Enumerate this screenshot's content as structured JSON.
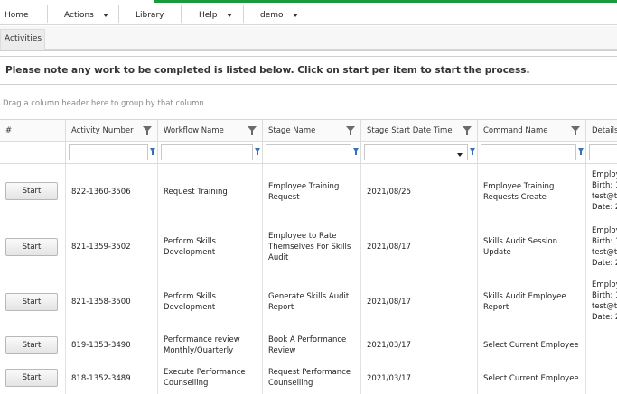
{
  "menu": {
    "home": "Home",
    "actions": "Actions",
    "library": "Library",
    "help": "Help",
    "user": "demo"
  },
  "tabs": {
    "activities": "Activities"
  },
  "notice": "Please note any work to be completed is listed below. Click on start per item to start the process.",
  "group_hint": "Drag a column header here to group by that column",
  "columns": {
    "index": "#",
    "activity_number": "Activity Number",
    "workflow_name": "Workflow Name",
    "stage_name": "Stage Name",
    "stage_start": "Stage Start Date Time",
    "command_name": "Command Name",
    "details": "Details"
  },
  "start_label": "Start",
  "rows": [
    {
      "activity_number": "822-1360-3506",
      "workflow_name": [
        "Request Training"
      ],
      "stage_name": [
        "Employee Training",
        "Request"
      ],
      "stage_start": "2021/08/25",
      "command_name": [
        "Employee Training",
        "Requests Create"
      ],
      "details": [
        "Employ",
        "Birth: 1",
        "test@t",
        "Date: 2"
      ]
    },
    {
      "activity_number": "821-1359-3502",
      "workflow_name": [
        "Perform Skills",
        "Development"
      ],
      "stage_name": [
        "Employee to Rate",
        "Themselves For Skills",
        "Audit"
      ],
      "stage_start": "2021/08/17",
      "command_name": [
        "Skills Audit Session",
        "Update"
      ],
      "details": [
        "Employ",
        "Birth: 1",
        "test@t",
        "Date: 2"
      ]
    },
    {
      "activity_number": "821-1358-3500",
      "workflow_name": [
        "Perform Skills",
        "Development"
      ],
      "stage_name": [
        "Generate Skills Audit",
        "Report"
      ],
      "stage_start": "2021/08/17",
      "command_name": [
        "Skills Audit Employee",
        "Report"
      ],
      "details": [
        "Employ",
        "Birth: 1",
        "test@t",
        "Date: 2"
      ]
    },
    {
      "activity_number": "819-1353-3490",
      "workflow_name": [
        "Performance review",
        "Monthly/Quarterly"
      ],
      "stage_name": [
        "Book A Performance",
        "Review"
      ],
      "stage_start": "2021/03/17",
      "command_name": [
        "Select Current Employee"
      ],
      "details": []
    },
    {
      "activity_number": "818-1352-3489",
      "workflow_name": [
        "Execute Performance",
        "Counselling"
      ],
      "stage_name": [
        "Request Performance",
        "Counselling"
      ],
      "stage_start": "2021/03/17",
      "command_name": [
        "Select Current Employee"
      ],
      "details": []
    }
  ]
}
